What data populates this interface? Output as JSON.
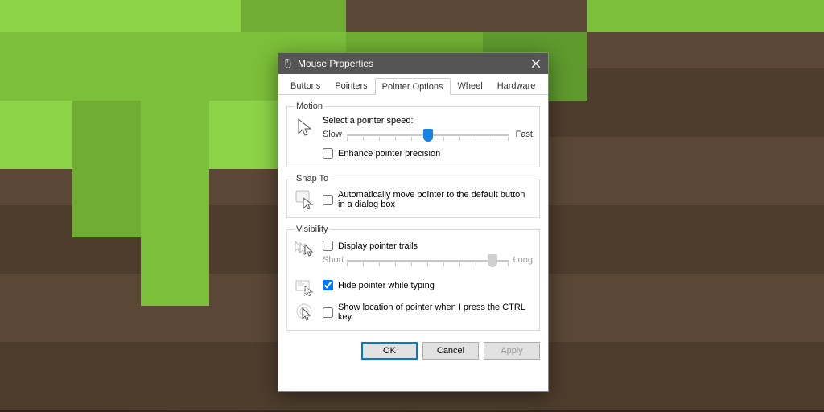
{
  "window": {
    "title": "Mouse Properties"
  },
  "tabs": {
    "buttons": "Buttons",
    "pointers": "Pointers",
    "pointer_options": "Pointer Options",
    "wheel": "Wheel",
    "hardware": "Hardware",
    "active": "pointer_options"
  },
  "motion": {
    "legend": "Motion",
    "select_speed": "Select a pointer speed:",
    "slow": "Slow",
    "fast": "Fast",
    "speed_value": 6,
    "speed_max": 11,
    "enhance": {
      "label": "Enhance pointer precision",
      "checked": false
    }
  },
  "snapto": {
    "legend": "Snap To",
    "auto": {
      "label": "Automatically move pointer to the default button in a dialog box",
      "checked": false
    }
  },
  "visibility": {
    "legend": "Visibility",
    "trails": {
      "label": "Display pointer trails",
      "checked": false
    },
    "trails_short": "Short",
    "trails_long": "Long",
    "trails_value": 10,
    "trails_max": 11,
    "trails_enabled": false,
    "hide": {
      "label": "Hide pointer while typing",
      "checked": true
    },
    "show": {
      "label": "Show location of pointer when I press the CTRL key",
      "checked": false
    }
  },
  "buttons": {
    "ok": "OK",
    "cancel": "Cancel",
    "apply": "Apply",
    "apply_enabled": false
  }
}
